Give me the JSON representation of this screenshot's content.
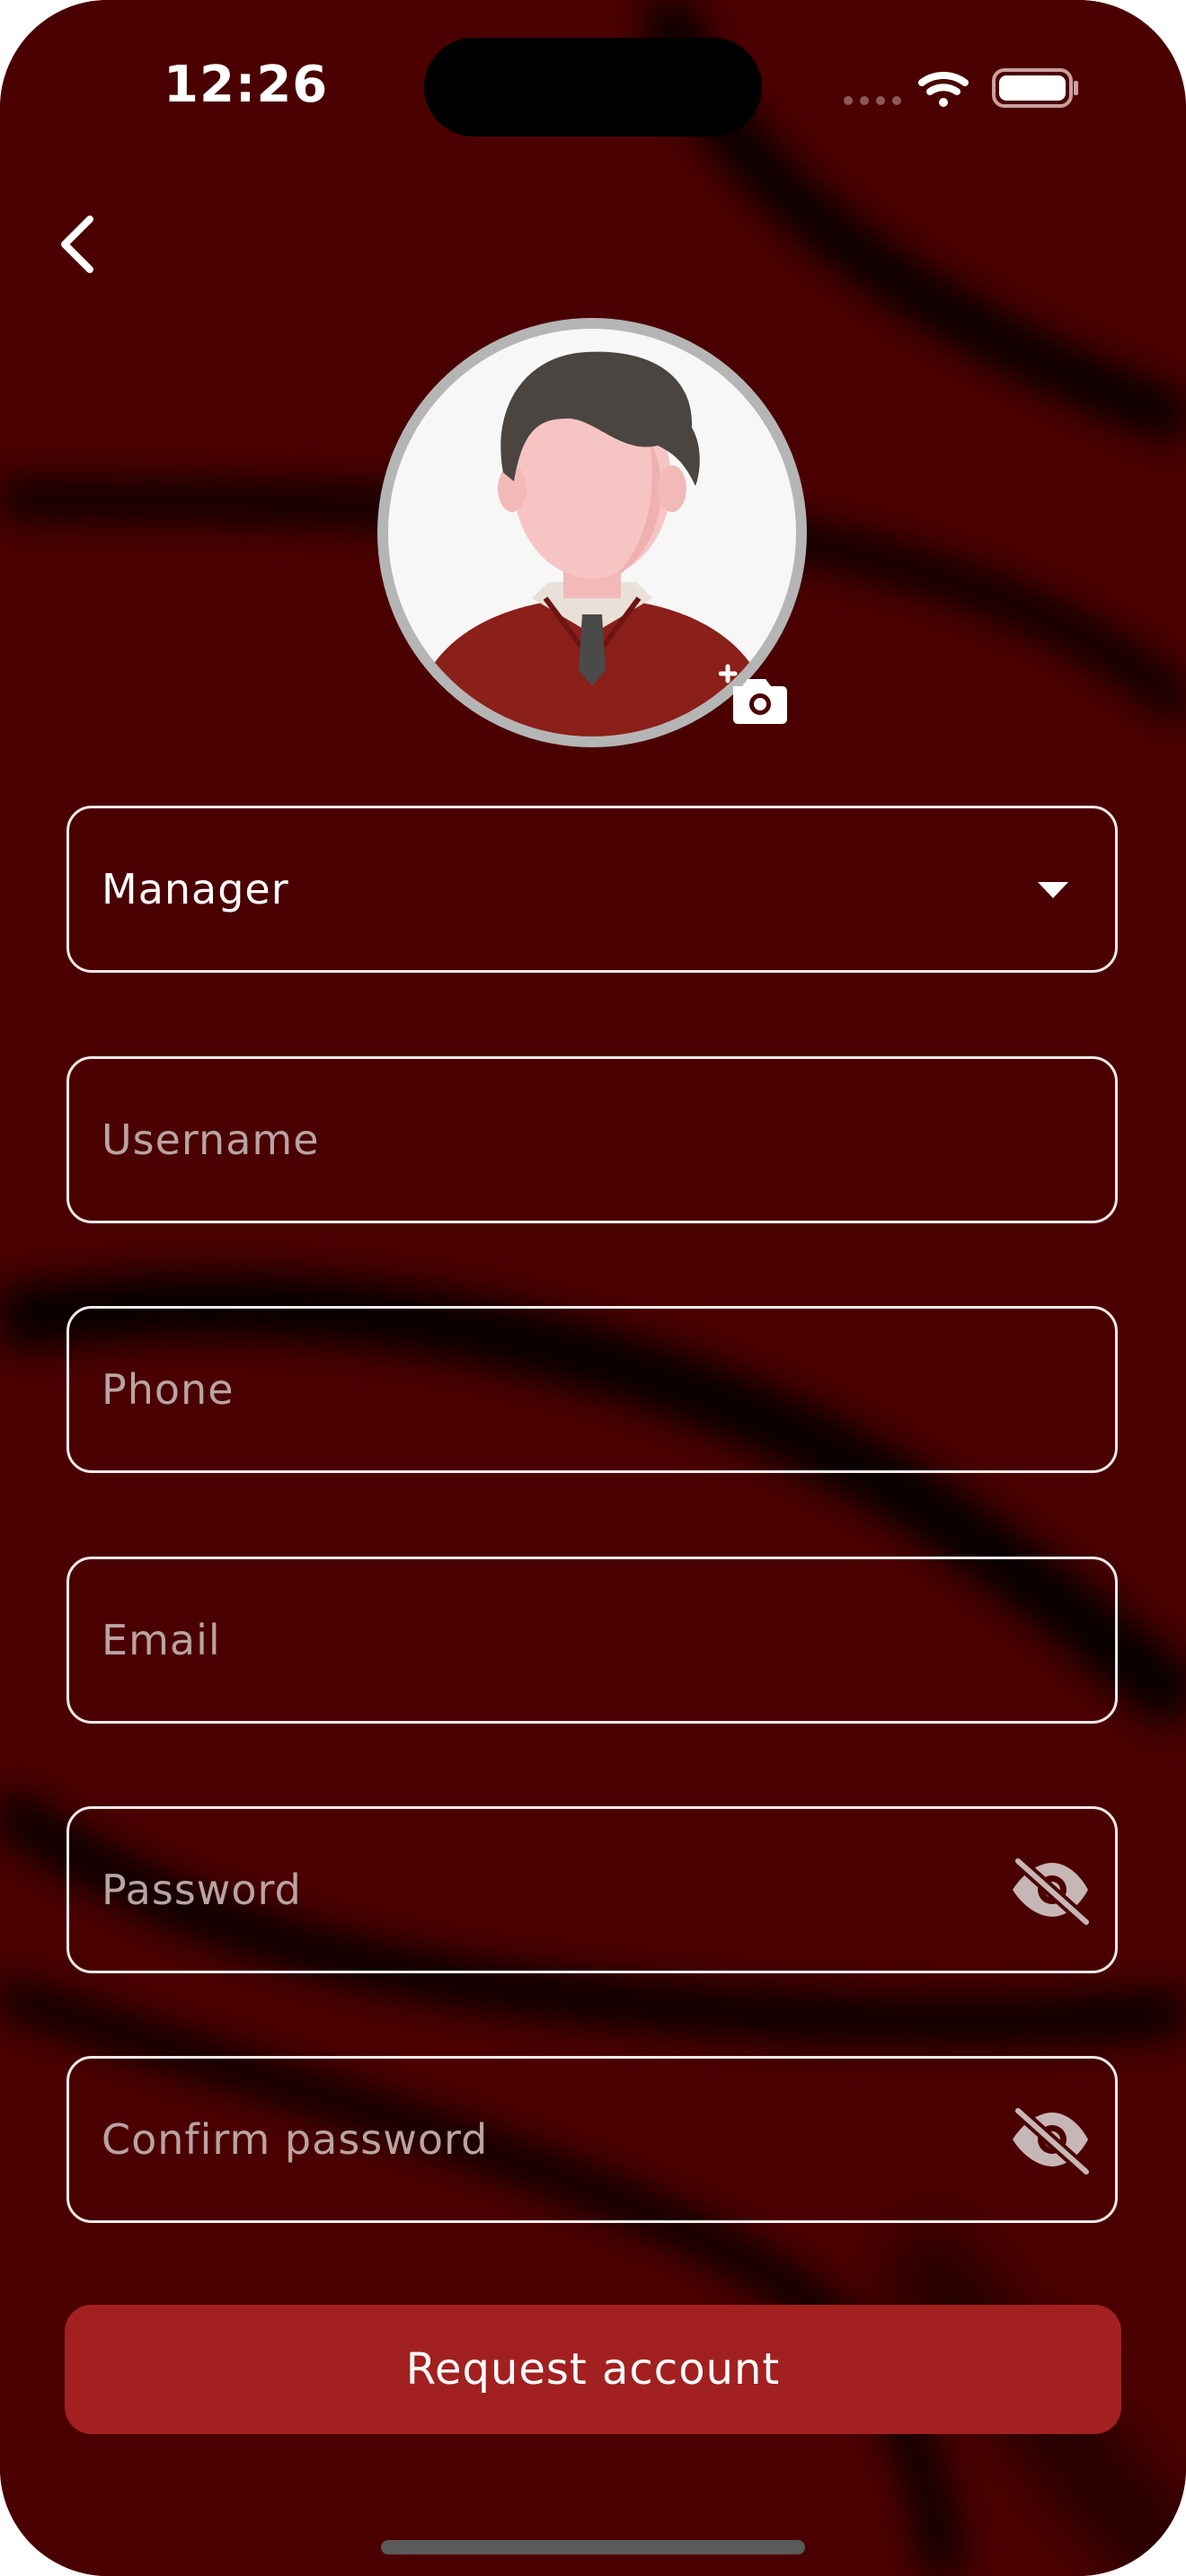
{
  "status_bar": {
    "time": "12:26",
    "icons": [
      "cellular-dots-icon",
      "wifi-icon",
      "battery-icon"
    ]
  },
  "nav": {
    "back_icon": "chevron-left-icon"
  },
  "profile": {
    "avatar_icon": "person-avatar-icon",
    "add_photo_icon": "add-photo-camera-icon"
  },
  "form": {
    "role_select": {
      "value": "Manager",
      "icon": "dropdown-caret-icon"
    },
    "username": {
      "placeholder": "Username"
    },
    "phone": {
      "placeholder": "Phone"
    },
    "email": {
      "placeholder": "Email"
    },
    "password": {
      "placeholder": "Password",
      "toggle_icon": "eye-off-icon"
    },
    "confirm_password": {
      "placeholder": "Confirm password",
      "toggle_icon": "eye-off-icon"
    },
    "submit_label": "Request account"
  },
  "colors": {
    "background": "#4b0000",
    "accent_button": "#a32020",
    "field_border": "#f2e8e8",
    "placeholder_text": "#b9a3a3"
  }
}
